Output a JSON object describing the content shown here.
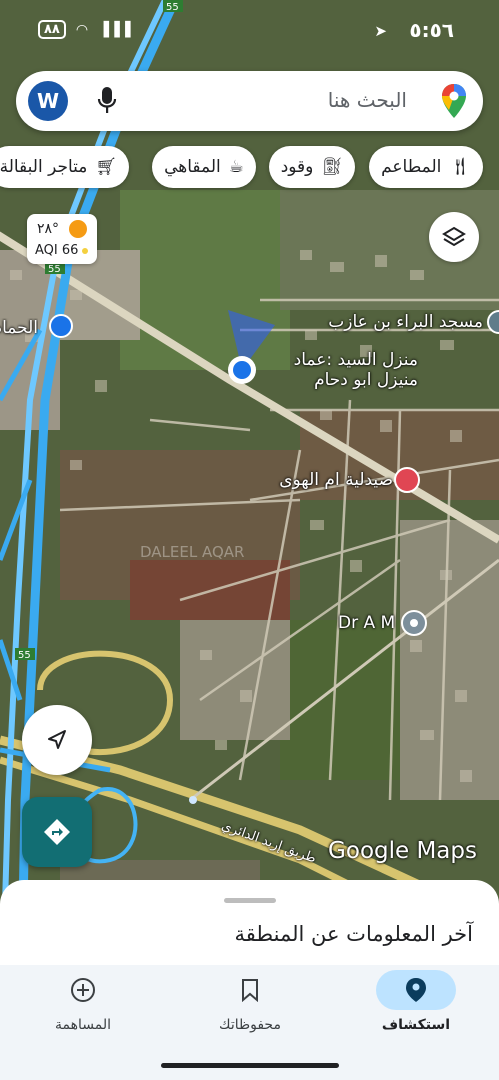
{
  "status_bar": {
    "time": "٥:٥٦",
    "battery": "٨٨"
  },
  "search": {
    "avatar_letter": "W",
    "placeholder": "البحث هنا"
  },
  "chips": [
    "المطاعم",
    "وقود",
    "المقاهي",
    "متاجر البقالة"
  ],
  "weather": {
    "temp": "٢٨°",
    "aqi": "AQI 66"
  },
  "map_labels": {
    "house": "منزل السيد :عماد منيزل ابو دحام",
    "mosque": "مسجد البراء بن عازب",
    "pharmacy": "صيدلية ام الهوى",
    "doctor": "Dr A M",
    "road": "طريق إربد الدائري",
    "left_poi": "الحمام",
    "watermark": "DALEEL AQAR",
    "shield_a": "55",
    "shield_b": "55",
    "shield_c": "55"
  },
  "google_logo": "Google Maps",
  "sheet": {
    "title": "آخر المعلومات عن المنطقة"
  },
  "bottom_nav": [
    {
      "label": "استكشاف",
      "icon": "location-pin-icon",
      "active": true
    },
    {
      "label": "محفوظاتك",
      "icon": "bookmark-icon",
      "active": false
    },
    {
      "label": "المساهمة",
      "icon": "add-circle-icon",
      "active": false
    }
  ],
  "colors": {
    "accent": "#1a73e8",
    "dir_button": "#126e73",
    "nav_active": "#bde3ff"
  }
}
